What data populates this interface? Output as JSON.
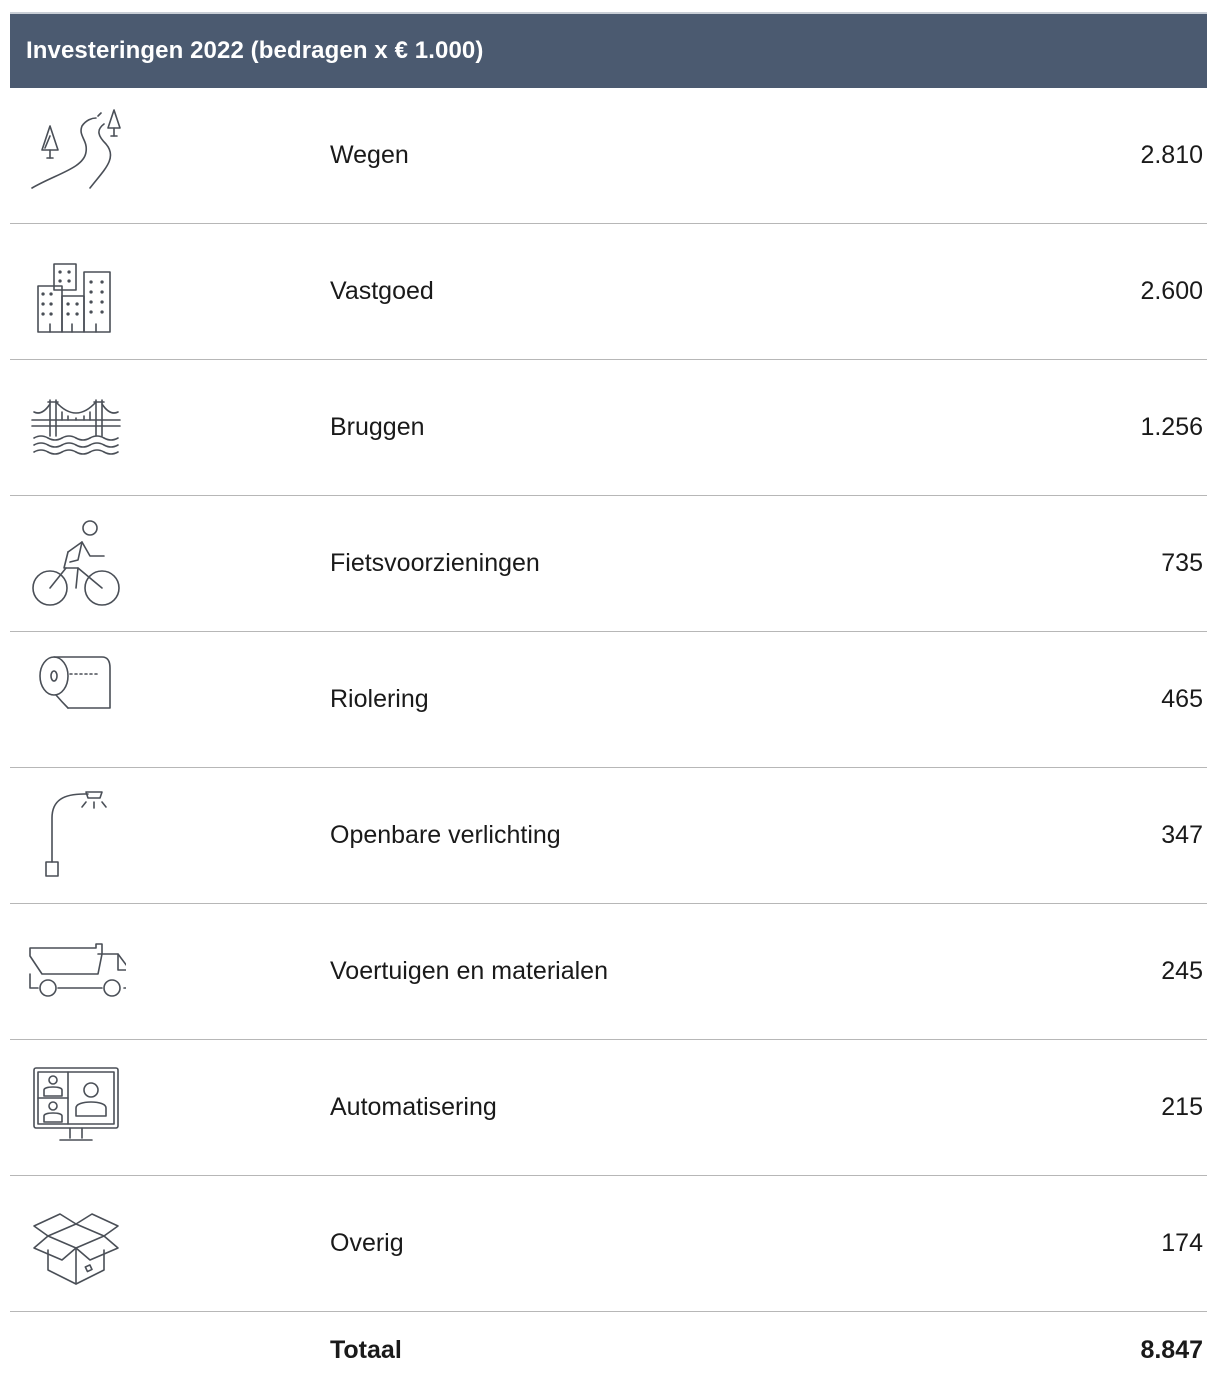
{
  "header": {
    "title": "Investeringen 2022 (bedragen x € 1.000)",
    "background_color": "#4b5a70"
  },
  "rows": [
    {
      "icon": "road-trees-icon",
      "label": "Wegen",
      "value": "2.810"
    },
    {
      "icon": "buildings-icon",
      "label": "Vastgoed",
      "value": "2.600"
    },
    {
      "icon": "bridge-icon",
      "label": "Bruggen",
      "value": "1.256"
    },
    {
      "icon": "cyclist-icon",
      "label": "Fietsvoorzieningen",
      "value": "735"
    },
    {
      "icon": "sewer-pipe-roll-icon",
      "label": "Riolering",
      "value": "465"
    },
    {
      "icon": "street-lamp-icon",
      "label": "Openbare verlichting",
      "value": "347"
    },
    {
      "icon": "dump-truck-icon",
      "label": "Voertuigen en materialen",
      "value": "245"
    },
    {
      "icon": "monitor-video-call-icon",
      "label": "Automatisering",
      "value": "215"
    },
    {
      "icon": "open-box-icon",
      "label": "Overig",
      "value": "174"
    }
  ],
  "total": {
    "label": "Totaal",
    "value": "8.847"
  }
}
